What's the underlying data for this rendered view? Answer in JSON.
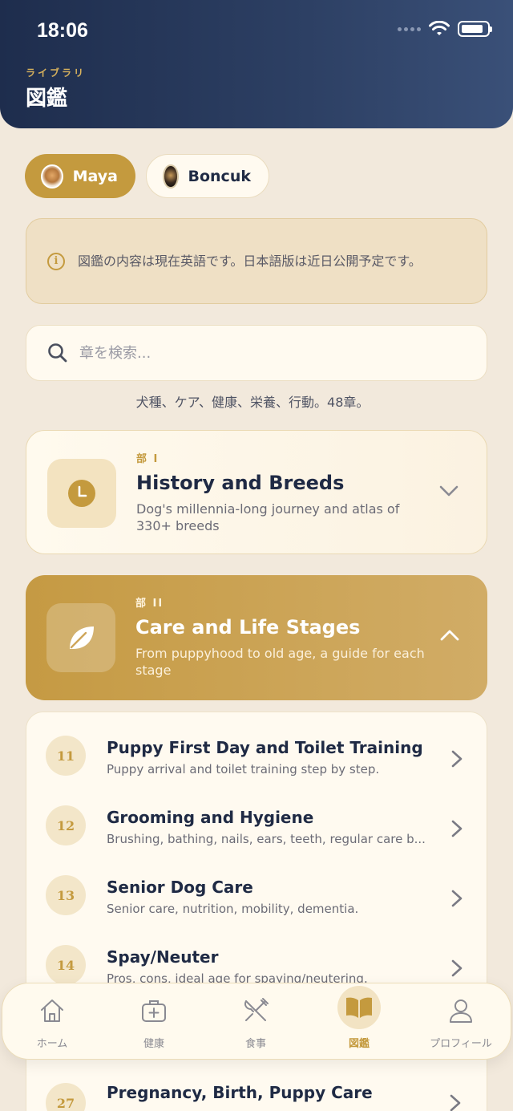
{
  "status_bar": {
    "time": "18:06"
  },
  "header": {
    "kicker": "ライブラリ",
    "title": "図鑑"
  },
  "pets": [
    {
      "name": "Maya",
      "selected": true
    },
    {
      "name": "Boncuk",
      "selected": false
    }
  ],
  "notice": {
    "text": "図鑑の内容は現在英語です。日本語版は近日公開予定です。"
  },
  "search": {
    "placeholder": "章を検索..."
  },
  "subtitle": "犬種、ケア、健康、栄養、行動。48章。",
  "parts": [
    {
      "label": "部 I",
      "title": "History and Breeds",
      "description": "Dog's millennia-long journey and atlas of 330+ breeds",
      "icon": "clock-icon",
      "expanded": false
    },
    {
      "label": "部 II",
      "title": "Care and Life Stages",
      "description": "From puppyhood to old age, a guide for each stage",
      "icon": "leaf-icon",
      "expanded": true
    }
  ],
  "chapters": [
    {
      "number": "11",
      "title": "Puppy First Day and Toilet Training",
      "description": "Puppy arrival and toilet training step by step."
    },
    {
      "number": "12",
      "title": "Grooming and Hygiene",
      "description": "Brushing, bathing, nails, ears, teeth, regular care b..."
    },
    {
      "number": "13",
      "title": "Senior Dog Care",
      "description": "Senior care, nutrition, mobility, dementia."
    },
    {
      "number": "14",
      "title": "Spay/Neuter",
      "description": "Pros, cons, ideal age for spaying/neutering."
    }
  ],
  "chapter_bottom": {
    "number": "27",
    "title": "Pregnancy, Birth, Puppy Care"
  },
  "tabs": [
    {
      "label": "ホーム",
      "icon": "home-icon",
      "active": false
    },
    {
      "label": "健康",
      "icon": "medical-kit-icon",
      "active": false
    },
    {
      "label": "食事",
      "icon": "fork-knife-icon",
      "active": false
    },
    {
      "label": "図鑑",
      "icon": "book-icon",
      "active": true
    },
    {
      "label": "プロフィール",
      "icon": "person-icon",
      "active": false
    }
  ],
  "colors": {
    "accent": "#c49a3e",
    "navy": "#1e2d4d",
    "background": "#f2e9dc"
  }
}
